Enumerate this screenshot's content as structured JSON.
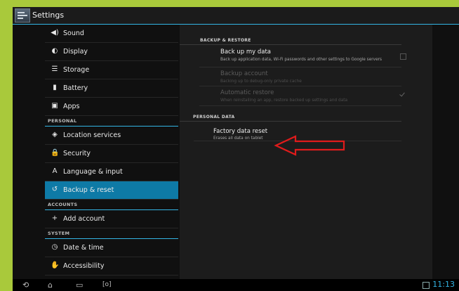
{
  "app": {
    "title": "Settings"
  },
  "headers": {
    "items": [
      {
        "label": "Sound",
        "icon": "speaker-icon",
        "glyph": "◀)"
      },
      {
        "label": "Display",
        "icon": "brightness-icon",
        "glyph": "◐"
      },
      {
        "label": "Storage",
        "icon": "storage-icon",
        "glyph": "☰"
      },
      {
        "label": "Battery",
        "icon": "battery-icon",
        "glyph": "▮"
      },
      {
        "label": "Apps",
        "icon": "apps-icon",
        "glyph": "▣"
      }
    ],
    "personal_category": "PERSONAL",
    "personal_items": [
      {
        "label": "Location services",
        "icon": "location-icon",
        "glyph": "◈"
      },
      {
        "label": "Security",
        "icon": "lock-icon",
        "glyph": "🔒"
      },
      {
        "label": "Language & input",
        "icon": "keyboard-icon",
        "glyph": "A"
      },
      {
        "label": "Backup & reset",
        "icon": "backup-icon",
        "glyph": "↺",
        "selected": true
      }
    ],
    "accounts_category": "ACCOUNTS",
    "accounts_items": [
      {
        "label": "Add account",
        "icon": "plus-icon",
        "glyph": "+"
      }
    ],
    "system_category": "SYSTEM",
    "system_items": [
      {
        "label": "Date & time",
        "icon": "clock-icon",
        "glyph": "◷"
      },
      {
        "label": "Accessibility",
        "icon": "accessibility-icon",
        "glyph": "✋"
      }
    ]
  },
  "detail": {
    "backup_category": "BACKUP & RESTORE",
    "backup_my_data": {
      "title": "Back up my data",
      "summary": "Back up application data, Wi-Fi passwords and other settings to Google servers",
      "checked": false
    },
    "backup_account": {
      "title": "Backup account",
      "summary": "Backing up to debug-only private cache"
    },
    "automatic_restore": {
      "title": "Automatic restore",
      "summary": "When reinstalling an app, restore backed up settings and data",
      "checked": true
    },
    "personal_data_category": "PERSONAL DATA",
    "factory_reset": {
      "title": "Factory data reset",
      "summary": "Erases all data on tablet"
    }
  },
  "annotation": {
    "color": "#e01b1b"
  },
  "navbar": {
    "back_icon": "back-icon",
    "home_icon": "home-icon",
    "recents_icon": "recent-apps-icon",
    "screenshot_icon": "screenshot-icon",
    "time": "11:13"
  },
  "colors": {
    "accent": "#33b5e5",
    "selected": "#0e7aa6",
    "background": "#a9c93b"
  }
}
